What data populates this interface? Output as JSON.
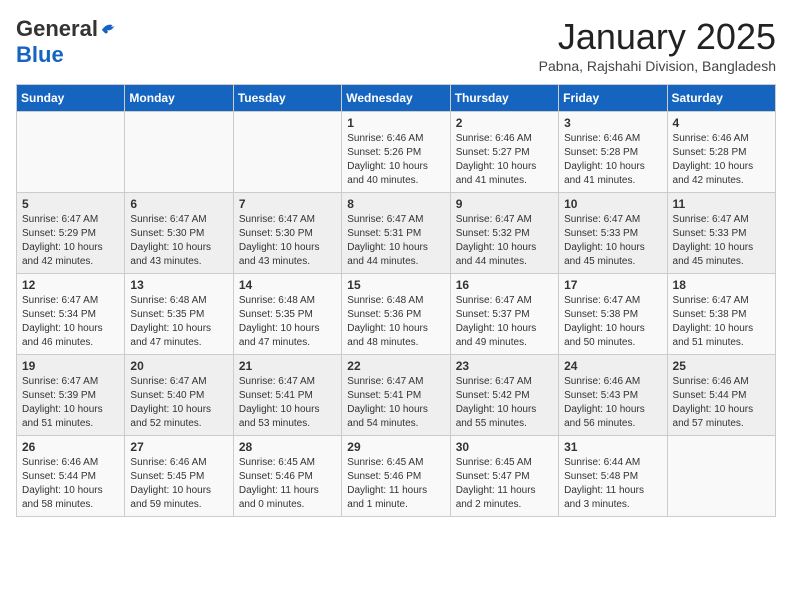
{
  "header": {
    "logo_general": "General",
    "logo_blue": "Blue",
    "month_title": "January 2025",
    "location": "Pabna, Rajshahi Division, Bangladesh"
  },
  "weekdays": [
    "Sunday",
    "Monday",
    "Tuesday",
    "Wednesday",
    "Thursday",
    "Friday",
    "Saturday"
  ],
  "weeks": [
    [
      {
        "day": "",
        "sunrise": "",
        "sunset": "",
        "daylight": ""
      },
      {
        "day": "",
        "sunrise": "",
        "sunset": "",
        "daylight": ""
      },
      {
        "day": "",
        "sunrise": "",
        "sunset": "",
        "daylight": ""
      },
      {
        "day": "1",
        "sunrise": "Sunrise: 6:46 AM",
        "sunset": "Sunset: 5:26 PM",
        "daylight": "Daylight: 10 hours and 40 minutes."
      },
      {
        "day": "2",
        "sunrise": "Sunrise: 6:46 AM",
        "sunset": "Sunset: 5:27 PM",
        "daylight": "Daylight: 10 hours and 41 minutes."
      },
      {
        "day": "3",
        "sunrise": "Sunrise: 6:46 AM",
        "sunset": "Sunset: 5:28 PM",
        "daylight": "Daylight: 10 hours and 41 minutes."
      },
      {
        "day": "4",
        "sunrise": "Sunrise: 6:46 AM",
        "sunset": "Sunset: 5:28 PM",
        "daylight": "Daylight: 10 hours and 42 minutes."
      }
    ],
    [
      {
        "day": "5",
        "sunrise": "Sunrise: 6:47 AM",
        "sunset": "Sunset: 5:29 PM",
        "daylight": "Daylight: 10 hours and 42 minutes."
      },
      {
        "day": "6",
        "sunrise": "Sunrise: 6:47 AM",
        "sunset": "Sunset: 5:30 PM",
        "daylight": "Daylight: 10 hours and 43 minutes."
      },
      {
        "day": "7",
        "sunrise": "Sunrise: 6:47 AM",
        "sunset": "Sunset: 5:30 PM",
        "daylight": "Daylight: 10 hours and 43 minutes."
      },
      {
        "day": "8",
        "sunrise": "Sunrise: 6:47 AM",
        "sunset": "Sunset: 5:31 PM",
        "daylight": "Daylight: 10 hours and 44 minutes."
      },
      {
        "day": "9",
        "sunrise": "Sunrise: 6:47 AM",
        "sunset": "Sunset: 5:32 PM",
        "daylight": "Daylight: 10 hours and 44 minutes."
      },
      {
        "day": "10",
        "sunrise": "Sunrise: 6:47 AM",
        "sunset": "Sunset: 5:33 PM",
        "daylight": "Daylight: 10 hours and 45 minutes."
      },
      {
        "day": "11",
        "sunrise": "Sunrise: 6:47 AM",
        "sunset": "Sunset: 5:33 PM",
        "daylight": "Daylight: 10 hours and 45 minutes."
      }
    ],
    [
      {
        "day": "12",
        "sunrise": "Sunrise: 6:47 AM",
        "sunset": "Sunset: 5:34 PM",
        "daylight": "Daylight: 10 hours and 46 minutes."
      },
      {
        "day": "13",
        "sunrise": "Sunrise: 6:48 AM",
        "sunset": "Sunset: 5:35 PM",
        "daylight": "Daylight: 10 hours and 47 minutes."
      },
      {
        "day": "14",
        "sunrise": "Sunrise: 6:48 AM",
        "sunset": "Sunset: 5:35 PM",
        "daylight": "Daylight: 10 hours and 47 minutes."
      },
      {
        "day": "15",
        "sunrise": "Sunrise: 6:48 AM",
        "sunset": "Sunset: 5:36 PM",
        "daylight": "Daylight: 10 hours and 48 minutes."
      },
      {
        "day": "16",
        "sunrise": "Sunrise: 6:47 AM",
        "sunset": "Sunset: 5:37 PM",
        "daylight": "Daylight: 10 hours and 49 minutes."
      },
      {
        "day": "17",
        "sunrise": "Sunrise: 6:47 AM",
        "sunset": "Sunset: 5:38 PM",
        "daylight": "Daylight: 10 hours and 50 minutes."
      },
      {
        "day": "18",
        "sunrise": "Sunrise: 6:47 AM",
        "sunset": "Sunset: 5:38 PM",
        "daylight": "Daylight: 10 hours and 51 minutes."
      }
    ],
    [
      {
        "day": "19",
        "sunrise": "Sunrise: 6:47 AM",
        "sunset": "Sunset: 5:39 PM",
        "daylight": "Daylight: 10 hours and 51 minutes."
      },
      {
        "day": "20",
        "sunrise": "Sunrise: 6:47 AM",
        "sunset": "Sunset: 5:40 PM",
        "daylight": "Daylight: 10 hours and 52 minutes."
      },
      {
        "day": "21",
        "sunrise": "Sunrise: 6:47 AM",
        "sunset": "Sunset: 5:41 PM",
        "daylight": "Daylight: 10 hours and 53 minutes."
      },
      {
        "day": "22",
        "sunrise": "Sunrise: 6:47 AM",
        "sunset": "Sunset: 5:41 PM",
        "daylight": "Daylight: 10 hours and 54 minutes."
      },
      {
        "day": "23",
        "sunrise": "Sunrise: 6:47 AM",
        "sunset": "Sunset: 5:42 PM",
        "daylight": "Daylight: 10 hours and 55 minutes."
      },
      {
        "day": "24",
        "sunrise": "Sunrise: 6:46 AM",
        "sunset": "Sunset: 5:43 PM",
        "daylight": "Daylight: 10 hours and 56 minutes."
      },
      {
        "day": "25",
        "sunrise": "Sunrise: 6:46 AM",
        "sunset": "Sunset: 5:44 PM",
        "daylight": "Daylight: 10 hours and 57 minutes."
      }
    ],
    [
      {
        "day": "26",
        "sunrise": "Sunrise: 6:46 AM",
        "sunset": "Sunset: 5:44 PM",
        "daylight": "Daylight: 10 hours and 58 minutes."
      },
      {
        "day": "27",
        "sunrise": "Sunrise: 6:46 AM",
        "sunset": "Sunset: 5:45 PM",
        "daylight": "Daylight: 10 hours and 59 minutes."
      },
      {
        "day": "28",
        "sunrise": "Sunrise: 6:45 AM",
        "sunset": "Sunset: 5:46 PM",
        "daylight": "Daylight: 11 hours and 0 minutes."
      },
      {
        "day": "29",
        "sunrise": "Sunrise: 6:45 AM",
        "sunset": "Sunset: 5:46 PM",
        "daylight": "Daylight: 11 hours and 1 minute."
      },
      {
        "day": "30",
        "sunrise": "Sunrise: 6:45 AM",
        "sunset": "Sunset: 5:47 PM",
        "daylight": "Daylight: 11 hours and 2 minutes."
      },
      {
        "day": "31",
        "sunrise": "Sunrise: 6:44 AM",
        "sunset": "Sunset: 5:48 PM",
        "daylight": "Daylight: 11 hours and 3 minutes."
      },
      {
        "day": "",
        "sunrise": "",
        "sunset": "",
        "daylight": ""
      }
    ]
  ]
}
